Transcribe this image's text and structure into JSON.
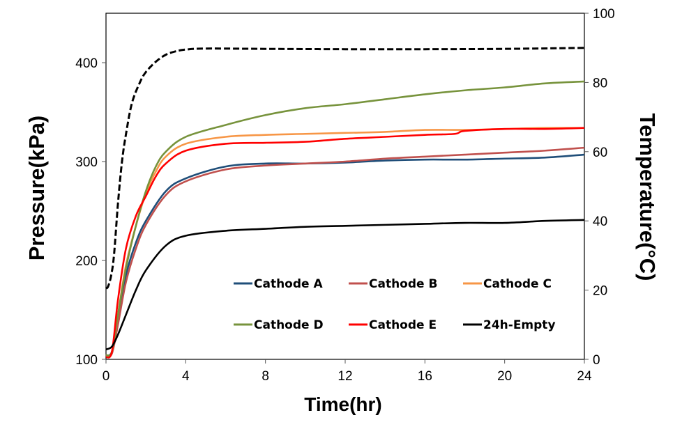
{
  "chart_data": {
    "type": "line",
    "title": "",
    "xlabel": "Time(hr)",
    "ylabel": "Pressure(kPa)",
    "y2label": "Temperature(°C)",
    "xlim": [
      0,
      24
    ],
    "ylim": [
      100,
      450
    ],
    "y2lim": [
      0,
      100
    ],
    "xticks": [
      0,
      4,
      8,
      12,
      16,
      20,
      24
    ],
    "yticks": [
      100,
      200,
      300,
      400
    ],
    "y2ticks": [
      0,
      20,
      40,
      60,
      80,
      100
    ],
    "grid": false,
    "legend_position": "bottom-right inside plot, 2 rows x 3 columns",
    "series": [
      {
        "name": "Cathode A",
        "color": "#1f4e79",
        "axis": "left",
        "x": [
          0,
          0.3,
          0.6,
          1,
          1.5,
          2,
          3,
          4,
          6,
          8,
          10,
          12,
          14,
          16,
          18,
          20,
          22,
          24
        ],
        "y": [
          104,
          108,
          140,
          185,
          218,
          240,
          270,
          283,
          295,
          298,
          298,
          299,
          301,
          302,
          302,
          303,
          304,
          307
        ]
      },
      {
        "name": "Cathode B",
        "color": "#c0504d",
        "axis": "left",
        "x": [
          0,
          0.3,
          0.6,
          1,
          1.5,
          2,
          3,
          4,
          6,
          8,
          10,
          12,
          14,
          16,
          18,
          20,
          22,
          24
        ],
        "y": [
          103,
          106,
          135,
          178,
          212,
          236,
          266,
          280,
          292,
          296,
          298,
          300,
          303,
          305,
          307,
          309,
          311,
          314
        ]
      },
      {
        "name": "Cathode C",
        "color": "#f79646",
        "axis": "left",
        "x": [
          0,
          0.3,
          0.6,
          1,
          1.5,
          2,
          2.5,
          3,
          4,
          6,
          8,
          10,
          12,
          14,
          16,
          18,
          20,
          22,
          24
        ],
        "y": [
          104,
          108,
          145,
          195,
          235,
          268,
          290,
          305,
          318,
          325,
          327,
          328,
          329,
          330,
          332,
          332,
          333,
          334,
          334
        ]
      },
      {
        "name": "Cathode D",
        "color": "#77933c",
        "axis": "left",
        "x": [
          0,
          0.3,
          0.6,
          1,
          1.5,
          2,
          2.5,
          3,
          4,
          6,
          8,
          10,
          12,
          14,
          16,
          18,
          20,
          22,
          24
        ],
        "y": [
          104,
          108,
          145,
          192,
          235,
          270,
          295,
          310,
          325,
          337,
          347,
          354,
          358,
          363,
          368,
          372,
          375,
          379,
          381
        ]
      },
      {
        "name": "Cathode E",
        "color": "#ff0000",
        "axis": "left",
        "x": [
          0,
          0.3,
          0.6,
          1,
          1.5,
          2,
          2.5,
          3,
          4,
          6,
          8,
          10,
          12,
          14,
          16,
          17.5,
          18,
          20,
          22,
          24
        ],
        "y": [
          102,
          108,
          160,
          212,
          245,
          265,
          285,
          298,
          311,
          318,
          319,
          320,
          323,
          325,
          327,
          328,
          331,
          333,
          333,
          334
        ]
      },
      {
        "name": "24h-Empty",
        "color": "#000000",
        "axis": "left",
        "x": [
          0,
          0.3,
          0.6,
          1,
          1.5,
          2,
          3,
          4,
          6,
          8,
          10,
          12,
          14,
          16,
          18,
          20,
          22,
          24
        ],
        "y": [
          110,
          113,
          125,
          145,
          170,
          190,
          215,
          225,
          230,
          232,
          234,
          235,
          236,
          237,
          238,
          238,
          240,
          241
        ]
      },
      {
        "color": "#000000",
        "axis": "right",
        "dashed": true,
        "x": [
          0,
          0.1,
          0.25,
          0.4,
          0.6,
          0.8,
          1,
          1.3,
          1.7,
          2,
          2.5,
          3,
          3.5,
          4,
          5,
          8,
          12,
          16,
          20,
          24
        ],
        "y": [
          20.5,
          21,
          24,
          30,
          45,
          57,
          65,
          74,
          80,
          83,
          86,
          88,
          89,
          89.5,
          89.8,
          89.7,
          89.6,
          89.6,
          89.7,
          90
        ]
      }
    ]
  }
}
